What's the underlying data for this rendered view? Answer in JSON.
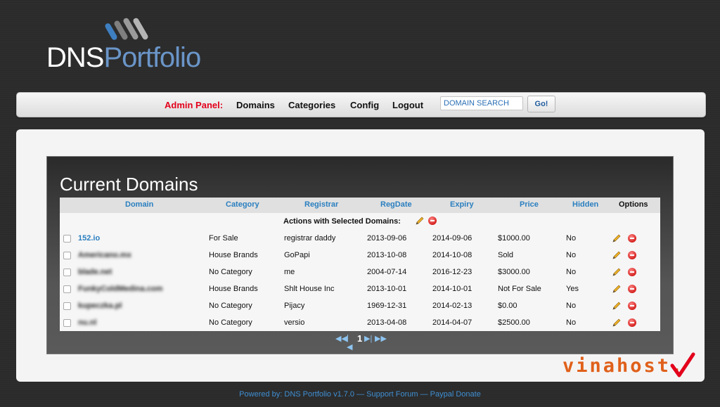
{
  "logo": {
    "dns": "DNS",
    "portfolio": "Portfolio"
  },
  "nav": {
    "admin_label": "Admin Panel:",
    "links": [
      "Domains",
      "Categories",
      "Config",
      "Logout"
    ],
    "search_placeholder": "DOMAIN SEARCH",
    "go_label": "Go!"
  },
  "panel": {
    "title": "Current Domains",
    "columns": [
      "Domain",
      "Category",
      "Registrar",
      "RegDate",
      "Expiry",
      "Price",
      "Hidden",
      "Options"
    ],
    "actions_label": "Actions with Selected Domains:",
    "rows": [
      {
        "domain": "152.io",
        "category": "For Sale",
        "registrar": "registrar daddy",
        "regdate": "2013-09-06",
        "expiry": "2014-09-06",
        "price": "$1000.00",
        "hidden": "No"
      },
      {
        "domain": "Americano.mx",
        "category": "House Brands",
        "registrar": "GoPapi",
        "regdate": "2013-10-08",
        "expiry": "2014-10-08",
        "price": "Sold",
        "hidden": "No"
      },
      {
        "domain": "blade.net",
        "category": "No Category",
        "registrar": "me",
        "regdate": "2004-07-14",
        "expiry": "2016-12-23",
        "price": "$3000.00",
        "hidden": "No"
      },
      {
        "domain": "FunkyColdMedina.com",
        "category": "House Brands",
        "registrar": "Shlt House Inc",
        "regdate": "2013-10-01",
        "expiry": "2014-10-01",
        "price": "Not For Sale",
        "hidden": "Yes"
      },
      {
        "domain": "kupeczka.pl",
        "category": "No Category",
        "registrar": "Pijacy",
        "regdate": "1969-12-31",
        "expiry": "2014-02-13",
        "price": "$0.00",
        "hidden": "No"
      },
      {
        "domain": "nu.nl",
        "category": "No Category",
        "registrar": "versio",
        "regdate": "2013-04-08",
        "expiry": "2014-04-07",
        "price": "$2500.00",
        "hidden": "No"
      }
    ],
    "pager": {
      "first": "◀◀",
      "prev": "|◀",
      "current": "1",
      "next": "▶|",
      "last": "▶▶"
    }
  },
  "watermark": "vinahost.",
  "footer": {
    "powered": "Powered by: DNS Portfolio v1.7.0",
    "sep": " — ",
    "forum": "Support Forum",
    "donate": "Paypal Donate"
  },
  "icons": {
    "edit": "pencil-icon",
    "delete": "delete-icon"
  },
  "colors": {
    "accent": "#2a7fc0",
    "admin": "#e3001b",
    "watermark": "#e0601a"
  }
}
